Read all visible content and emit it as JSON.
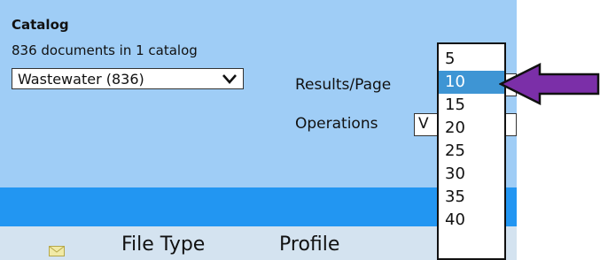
{
  "catalog": {
    "title": "Catalog",
    "doc_count": "836 documents in 1 catalog",
    "selected_catalog": "Wastewater (836)"
  },
  "results_per_page": {
    "label": "Results/Page",
    "options": [
      "5",
      "10",
      "15",
      "20",
      "25",
      "30",
      "35",
      "40"
    ],
    "selected": "10"
  },
  "operations": {
    "label": "Operations",
    "value": "V"
  },
  "table_header": {
    "columns": [
      "File Type",
      "Profile"
    ]
  },
  "icons": {
    "catalog_dropdown": "chevron-down-icon",
    "header_icon": "mail-icon",
    "callout": "arrow-left-icon"
  },
  "colors": {
    "panel_background": "#9fcdf6",
    "accent_bar": "#2296f2",
    "header_row": "#d4e3f0",
    "selected_option": "#3e95d4",
    "callout_arrow": "#7b2fa8"
  }
}
